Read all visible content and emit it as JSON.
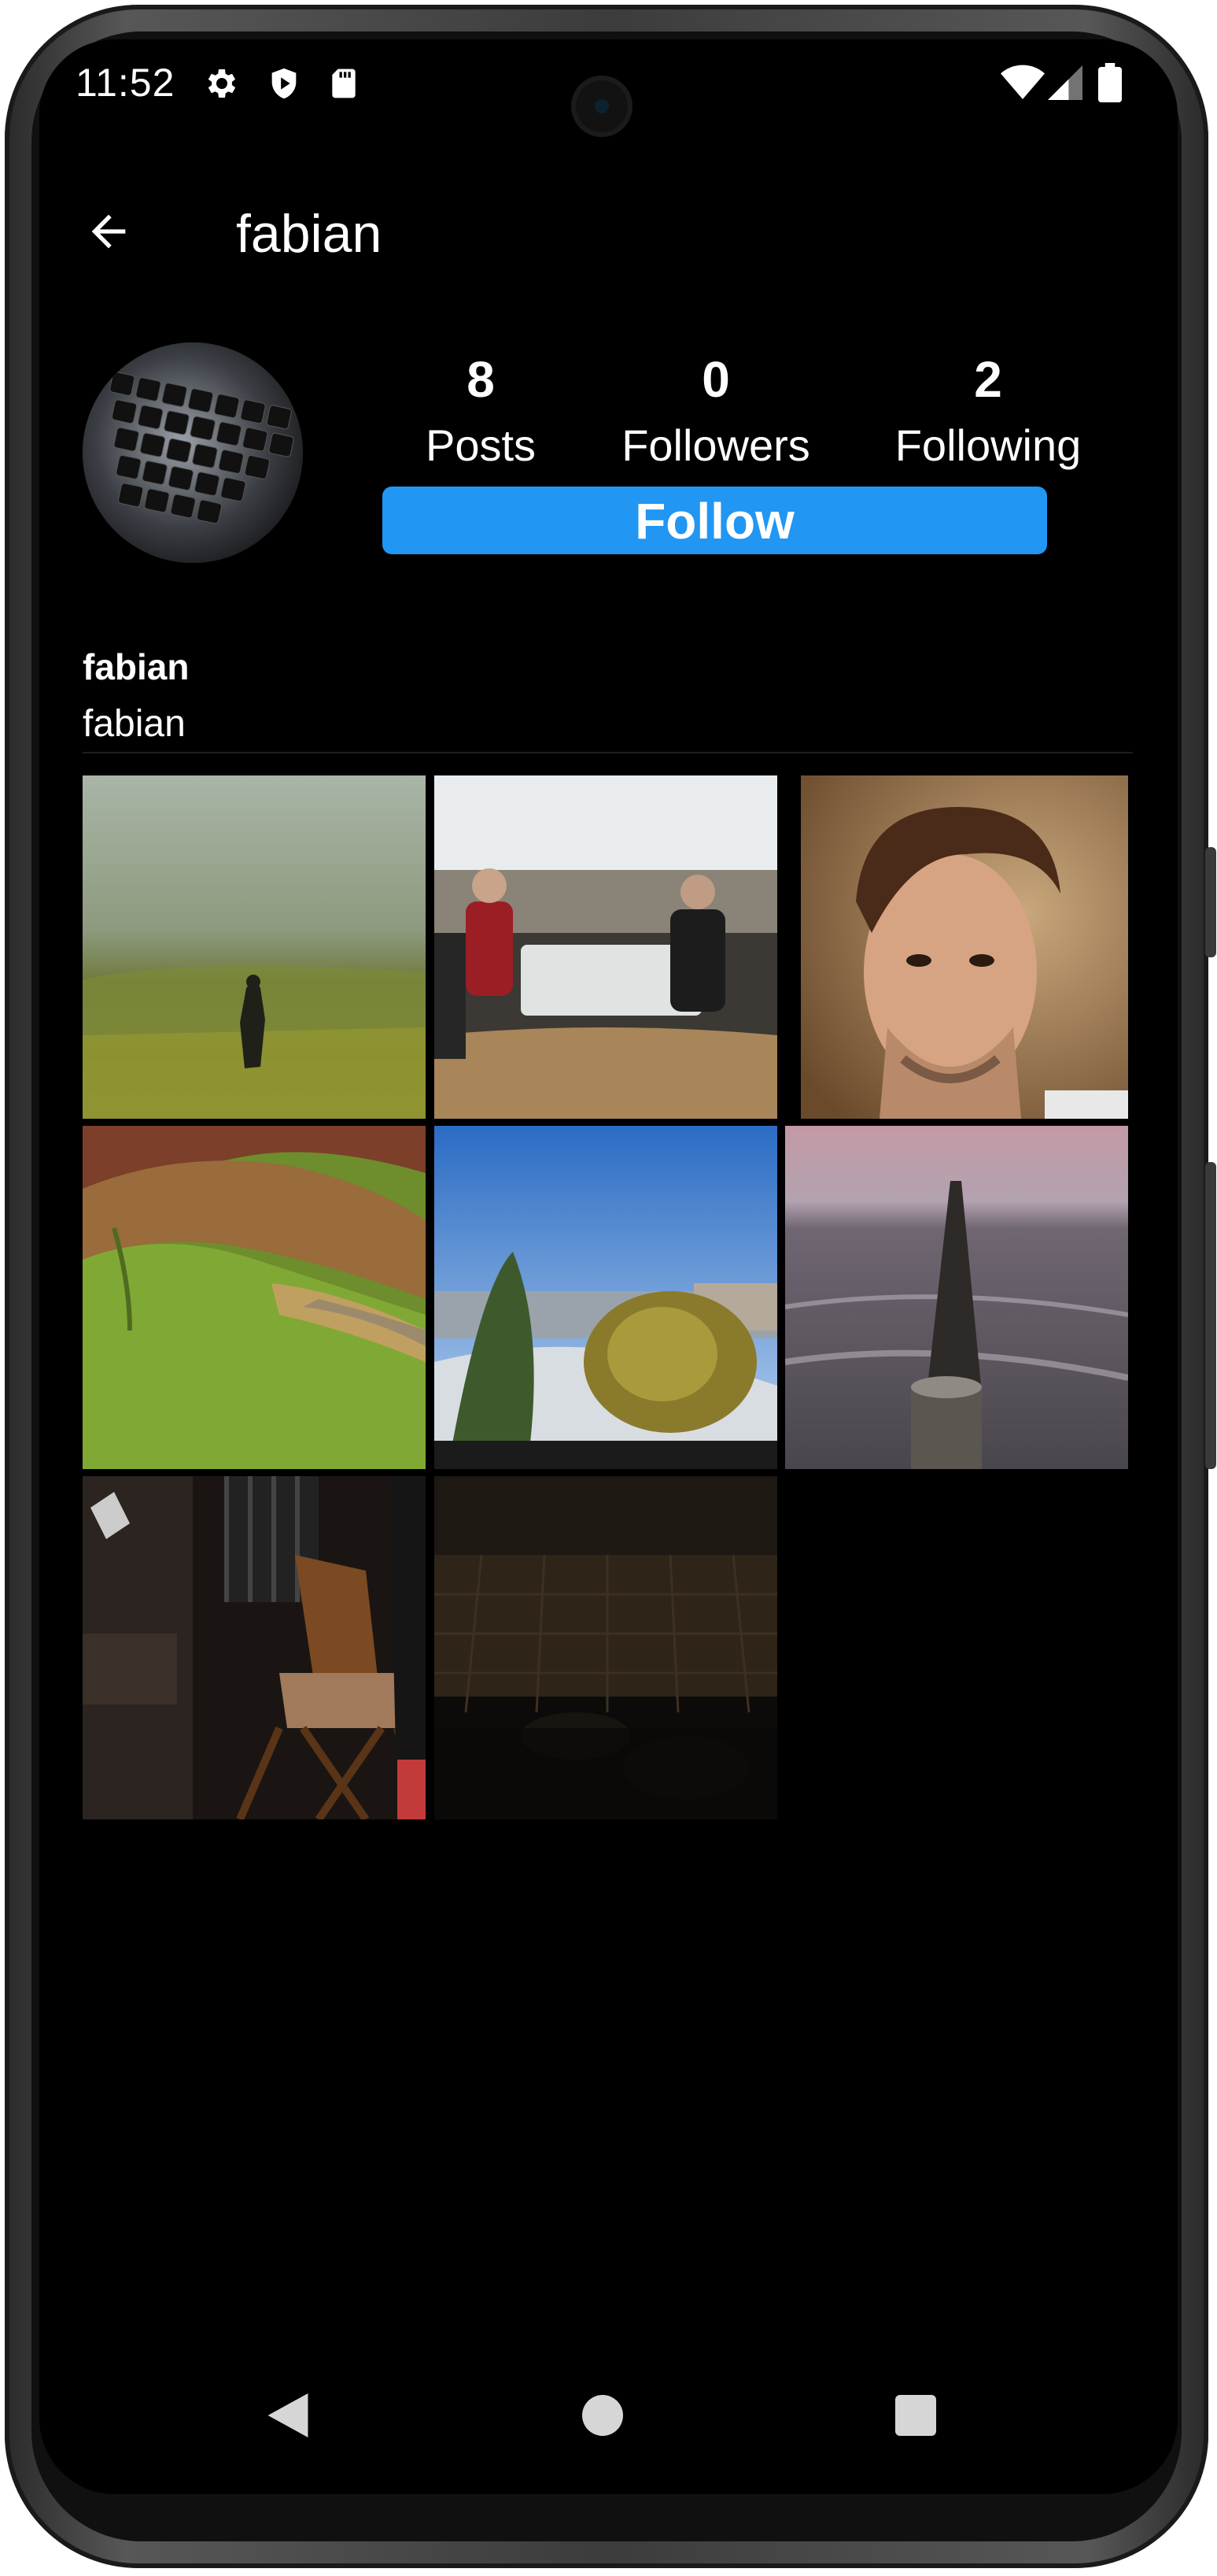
{
  "status_bar": {
    "time": "11:52",
    "icons": [
      "gear-icon",
      "shield-icon",
      "sd-card-icon",
      "wifi-icon",
      "signal-icon",
      "battery-icon"
    ]
  },
  "app_bar": {
    "title": "fabian",
    "back_icon": "arrow-back-icon"
  },
  "profile": {
    "avatar": "keyboard photo",
    "stats": [
      {
        "value": "8",
        "label": "Posts"
      },
      {
        "value": "0",
        "label": "Followers"
      },
      {
        "value": "2",
        "label": "Following"
      }
    ],
    "follow_label": "Follow",
    "username": "fabian",
    "bio": "fabian"
  },
  "posts": [
    {
      "subject": "foggy meadow with figure"
    },
    {
      "subject": "friends at table outdoors"
    },
    {
      "subject": "portrait of man"
    },
    {
      "subject": "green coastal hills"
    },
    {
      "subject": "garden with snow and sky"
    },
    {
      "subject": "sea with wooden posts"
    },
    {
      "subject": "leather chair interior"
    },
    {
      "subject": "dark night balcony"
    }
  ],
  "nav_bar": {
    "icons": [
      "nav-back-icon",
      "nav-home-icon",
      "nav-recents-icon"
    ]
  },
  "colors": {
    "accent": "#2196f3",
    "background": "#000000",
    "text": "#ffffff"
  }
}
